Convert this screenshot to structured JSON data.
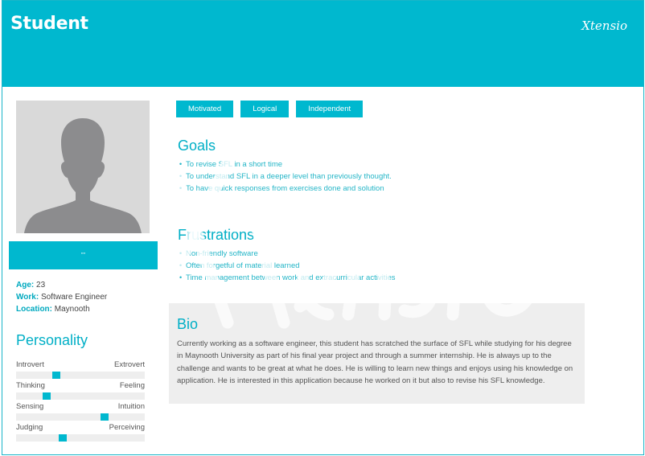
{
  "header": {
    "title": "Student",
    "brand": "Xtensio"
  },
  "profile": {
    "name_placeholder": "\"\"",
    "age_label": "Age:",
    "age": "23",
    "work_label": "Work:",
    "work": "Software Engineer",
    "location_label": "Location:",
    "location": "Maynooth"
  },
  "personality": {
    "title": "Personality",
    "sliders": [
      {
        "left": "Introvert",
        "right": "Extrovert",
        "level": 0.3
      },
      {
        "left": "Thinking",
        "right": "Feeling",
        "level": 0.22
      },
      {
        "left": "Sensing",
        "right": "Intuition",
        "level": 0.7
      },
      {
        "left": "Judging",
        "right": "Perceiving",
        "level": 0.35
      }
    ]
  },
  "tags": [
    "Motivated",
    "Logical",
    "Independent"
  ],
  "goals": {
    "title": "Goals",
    "items": [
      "To revise SFL in a short time",
      "To understand SFL in a deeper level than previously thought.",
      "To have quick responses from exercises done and solution"
    ]
  },
  "frustrations": {
    "title": "Frustrations",
    "items": [
      "Non-friendly software",
      "Often forgetful of material learned",
      "Time management between work and extracurricular activities"
    ]
  },
  "bio": {
    "title": "Bio",
    "text": "Currently working as a software engineer, this student has scratched the surface of SFL while studying for his degree in Maynooth University as part of his final year project and through a summer internship. He is always up to the challenge and wants to be great at what he does. He is willing to learn new things and enjoys using his knowledge on application. He is interested in this application because he worked on it but also to revise his SFL knowledge."
  },
  "colors": {
    "accent": "#00b8cf",
    "panel": "#eeeeee",
    "photo_bg": "#d9d9d9",
    "silhouette": "#8c8c8e"
  },
  "icons": {
    "photo": "person-silhouette-icon",
    "watermark": "xtensio-watermark"
  }
}
